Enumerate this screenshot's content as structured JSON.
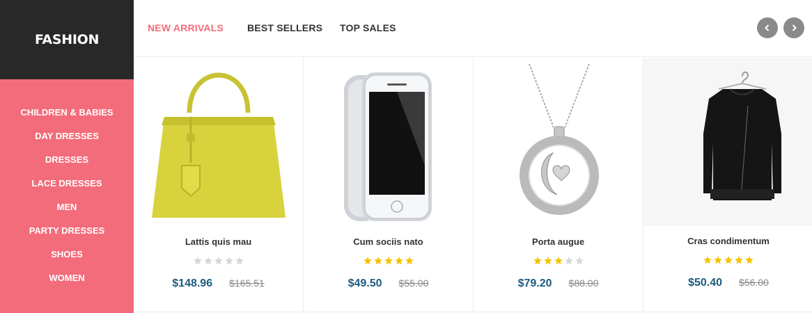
{
  "brand": {
    "name": "FASHION"
  },
  "categories": [
    {
      "label": "CHILDREN & BABIES"
    },
    {
      "label": "DAY DRESSES"
    },
    {
      "label": "DRESSES"
    },
    {
      "label": "LACE DRESSES"
    },
    {
      "label": "MEN"
    },
    {
      "label": "PARTY DRESSES"
    },
    {
      "label": "SHOES"
    },
    {
      "label": "WOMEN"
    }
  ],
  "tabs": [
    {
      "label": "NEW ARRIVALS",
      "active": true
    },
    {
      "label": "BEST SELLERS",
      "active": false
    },
    {
      "label": "TOP SALES",
      "active": false
    }
  ],
  "carousel": {
    "prev_icon": "chevron-left-icon",
    "next_icon": "chevron-right-icon"
  },
  "colors": {
    "accent": "#f36c7b",
    "brand_bg": "#282828",
    "price": "#1c5c80",
    "star_on": "#f5c200",
    "star_off": "#d6d6d6"
  },
  "products": [
    {
      "name": "Lattis quis mau",
      "image": "yellow-handbag",
      "rating": 0,
      "price": "$148.96",
      "old_price": "$165.51"
    },
    {
      "name": "Cum sociis nato",
      "image": "silver-smartphone",
      "rating": 5,
      "price": "$49.50",
      "old_price": "$55.00"
    },
    {
      "name": "Porta augue",
      "image": "moon-pendant-necklace",
      "rating": 3,
      "price": "$79.20",
      "old_price": "$88.00"
    },
    {
      "name": "Cras condimentum",
      "image": "black-jacket",
      "rating": 5,
      "price": "$50.40",
      "old_price": "$56.00"
    }
  ]
}
